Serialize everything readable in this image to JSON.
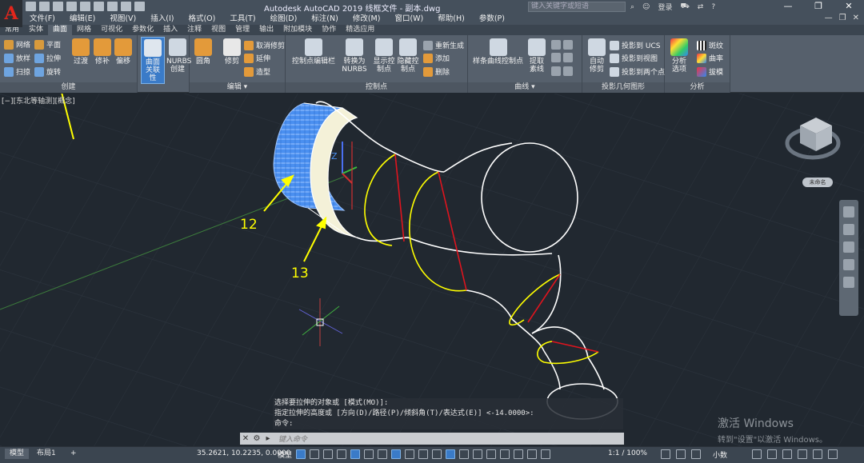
{
  "app": {
    "logo_letter": "A",
    "title": "Autodesk AutoCAD 2019    线框文件 - 副本.dwg",
    "search_placeholder": "键入关键字或短语",
    "login": "登录",
    "help": "?",
    "win_min": "—",
    "win_restore": "❐",
    "win_close": "✕"
  },
  "menu": [
    "文件(F)",
    "编辑(E)",
    "视图(V)",
    "插入(I)",
    "格式(O)",
    "工具(T)",
    "绘图(D)",
    "标注(N)",
    "修改(M)",
    "窗口(W)",
    "帮助(H)",
    "参数(P)"
  ],
  "menu_right": [
    "—",
    "❐",
    "✕"
  ],
  "tabs": [
    "常用",
    "实体",
    "曲面",
    "网格",
    "可视化",
    "参数化",
    "插入",
    "注释",
    "视图",
    "管理",
    "输出",
    "附加模块",
    "协作",
    "精选应用"
  ],
  "active_tab": "曲面",
  "ribbon": {
    "create": {
      "title": "创建",
      "items": [
        "网络",
        "平面",
        "放样",
        "拉伸",
        "扫掠",
        "旋转",
        "过渡",
        "修补",
        "偏移",
        "曲面关联性",
        "NURBS创建"
      ],
      "active": "曲面关联性"
    },
    "edit": {
      "title": "编辑 ▾",
      "items": [
        "圆角",
        "修剪",
        "取消修剪",
        "延伸",
        "造型"
      ]
    },
    "cp": {
      "title": "控制点",
      "items": [
        "控制点编辑栏",
        "转换为NURBS",
        "显示控制点",
        "隐藏控制点",
        "重新生成",
        "添加",
        "删除"
      ]
    },
    "curve": {
      "title": "曲线 ▾",
      "items": [
        "样条曲线控制点",
        "提取素线"
      ]
    },
    "proj": {
      "title": "投影几何图形",
      "items": [
        "自动修剪",
        "投影到 UCS",
        "投影到视图",
        "投影到两个点"
      ]
    },
    "analysis": {
      "title": "分析",
      "items": [
        "分析选项",
        "斑纹",
        "曲率",
        "拔模"
      ]
    }
  },
  "viewport": {
    "label": "[−][东北等轴测][概念]",
    "callouts": [
      "12",
      "13"
    ],
    "viewcube_label": "未命名",
    "ucs_z": "Z"
  },
  "command": {
    "history": [
      "选择要拉伸的对象或 [模式(MO)]:",
      "指定拉伸的高度或 [方向(D)/路径(P)/倾斜角(T)/表达式(E)] <-14.0000>:",
      "命令:"
    ],
    "placeholder": "键入命令"
  },
  "watermark": {
    "line1": "激活 Windows",
    "line2": "转到\"设置\"以激活 Windows。"
  },
  "status": {
    "layout_tabs": [
      "模型",
      "布局1",
      "+"
    ],
    "coords": "35.2621, 10.2235, 0.0000",
    "model": "模型",
    "scale": "1:1 / 100%",
    "small": "小数"
  },
  "colors": {
    "accent": "#3a7bc8",
    "wire": "#ffffff",
    "section": "#ffff00",
    "divider": "#e0141e",
    "callout": "#ffff00",
    "surface": "#4a8ff0"
  }
}
